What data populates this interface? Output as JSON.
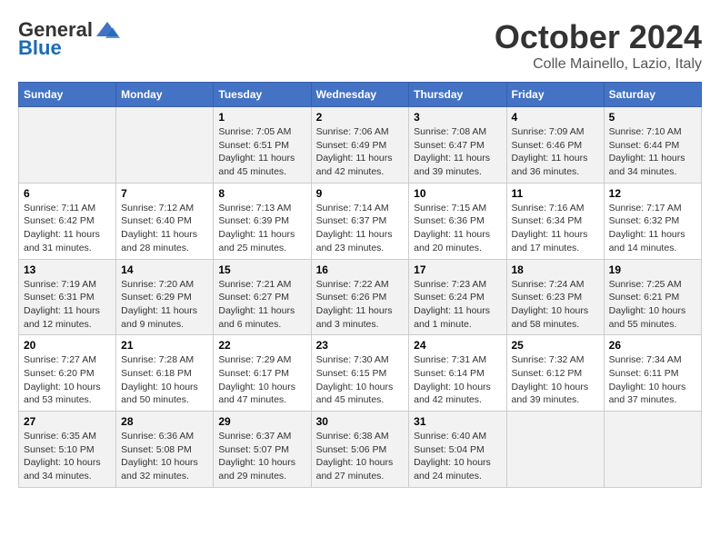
{
  "logo": {
    "general": "General",
    "blue": "Blue"
  },
  "title": "October 2024",
  "location": "Colle Mainello, Lazio, Italy",
  "days_header": [
    "Sunday",
    "Monday",
    "Tuesday",
    "Wednesday",
    "Thursday",
    "Friday",
    "Saturday"
  ],
  "weeks": [
    [
      {
        "day": "",
        "info": ""
      },
      {
        "day": "",
        "info": ""
      },
      {
        "day": "1",
        "info": "Sunrise: 7:05 AM\nSunset: 6:51 PM\nDaylight: 11 hours and 45 minutes."
      },
      {
        "day": "2",
        "info": "Sunrise: 7:06 AM\nSunset: 6:49 PM\nDaylight: 11 hours and 42 minutes."
      },
      {
        "day": "3",
        "info": "Sunrise: 7:08 AM\nSunset: 6:47 PM\nDaylight: 11 hours and 39 minutes."
      },
      {
        "day": "4",
        "info": "Sunrise: 7:09 AM\nSunset: 6:46 PM\nDaylight: 11 hours and 36 minutes."
      },
      {
        "day": "5",
        "info": "Sunrise: 7:10 AM\nSunset: 6:44 PM\nDaylight: 11 hours and 34 minutes."
      }
    ],
    [
      {
        "day": "6",
        "info": "Sunrise: 7:11 AM\nSunset: 6:42 PM\nDaylight: 11 hours and 31 minutes."
      },
      {
        "day": "7",
        "info": "Sunrise: 7:12 AM\nSunset: 6:40 PM\nDaylight: 11 hours and 28 minutes."
      },
      {
        "day": "8",
        "info": "Sunrise: 7:13 AM\nSunset: 6:39 PM\nDaylight: 11 hours and 25 minutes."
      },
      {
        "day": "9",
        "info": "Sunrise: 7:14 AM\nSunset: 6:37 PM\nDaylight: 11 hours and 23 minutes."
      },
      {
        "day": "10",
        "info": "Sunrise: 7:15 AM\nSunset: 6:36 PM\nDaylight: 11 hours and 20 minutes."
      },
      {
        "day": "11",
        "info": "Sunrise: 7:16 AM\nSunset: 6:34 PM\nDaylight: 11 hours and 17 minutes."
      },
      {
        "day": "12",
        "info": "Sunrise: 7:17 AM\nSunset: 6:32 PM\nDaylight: 11 hours and 14 minutes."
      }
    ],
    [
      {
        "day": "13",
        "info": "Sunrise: 7:19 AM\nSunset: 6:31 PM\nDaylight: 11 hours and 12 minutes."
      },
      {
        "day": "14",
        "info": "Sunrise: 7:20 AM\nSunset: 6:29 PM\nDaylight: 11 hours and 9 minutes."
      },
      {
        "day": "15",
        "info": "Sunrise: 7:21 AM\nSunset: 6:27 PM\nDaylight: 11 hours and 6 minutes."
      },
      {
        "day": "16",
        "info": "Sunrise: 7:22 AM\nSunset: 6:26 PM\nDaylight: 11 hours and 3 minutes."
      },
      {
        "day": "17",
        "info": "Sunrise: 7:23 AM\nSunset: 6:24 PM\nDaylight: 11 hours and 1 minute."
      },
      {
        "day": "18",
        "info": "Sunrise: 7:24 AM\nSunset: 6:23 PM\nDaylight: 10 hours and 58 minutes."
      },
      {
        "day": "19",
        "info": "Sunrise: 7:25 AM\nSunset: 6:21 PM\nDaylight: 10 hours and 55 minutes."
      }
    ],
    [
      {
        "day": "20",
        "info": "Sunrise: 7:27 AM\nSunset: 6:20 PM\nDaylight: 10 hours and 53 minutes."
      },
      {
        "day": "21",
        "info": "Sunrise: 7:28 AM\nSunset: 6:18 PM\nDaylight: 10 hours and 50 minutes."
      },
      {
        "day": "22",
        "info": "Sunrise: 7:29 AM\nSunset: 6:17 PM\nDaylight: 10 hours and 47 minutes."
      },
      {
        "day": "23",
        "info": "Sunrise: 7:30 AM\nSunset: 6:15 PM\nDaylight: 10 hours and 45 minutes."
      },
      {
        "day": "24",
        "info": "Sunrise: 7:31 AM\nSunset: 6:14 PM\nDaylight: 10 hours and 42 minutes."
      },
      {
        "day": "25",
        "info": "Sunrise: 7:32 AM\nSunset: 6:12 PM\nDaylight: 10 hours and 39 minutes."
      },
      {
        "day": "26",
        "info": "Sunrise: 7:34 AM\nSunset: 6:11 PM\nDaylight: 10 hours and 37 minutes."
      }
    ],
    [
      {
        "day": "27",
        "info": "Sunrise: 6:35 AM\nSunset: 5:10 PM\nDaylight: 10 hours and 34 minutes."
      },
      {
        "day": "28",
        "info": "Sunrise: 6:36 AM\nSunset: 5:08 PM\nDaylight: 10 hours and 32 minutes."
      },
      {
        "day": "29",
        "info": "Sunrise: 6:37 AM\nSunset: 5:07 PM\nDaylight: 10 hours and 29 minutes."
      },
      {
        "day": "30",
        "info": "Sunrise: 6:38 AM\nSunset: 5:06 PM\nDaylight: 10 hours and 27 minutes."
      },
      {
        "day": "31",
        "info": "Sunrise: 6:40 AM\nSunset: 5:04 PM\nDaylight: 10 hours and 24 minutes."
      },
      {
        "day": "",
        "info": ""
      },
      {
        "day": "",
        "info": ""
      }
    ]
  ]
}
